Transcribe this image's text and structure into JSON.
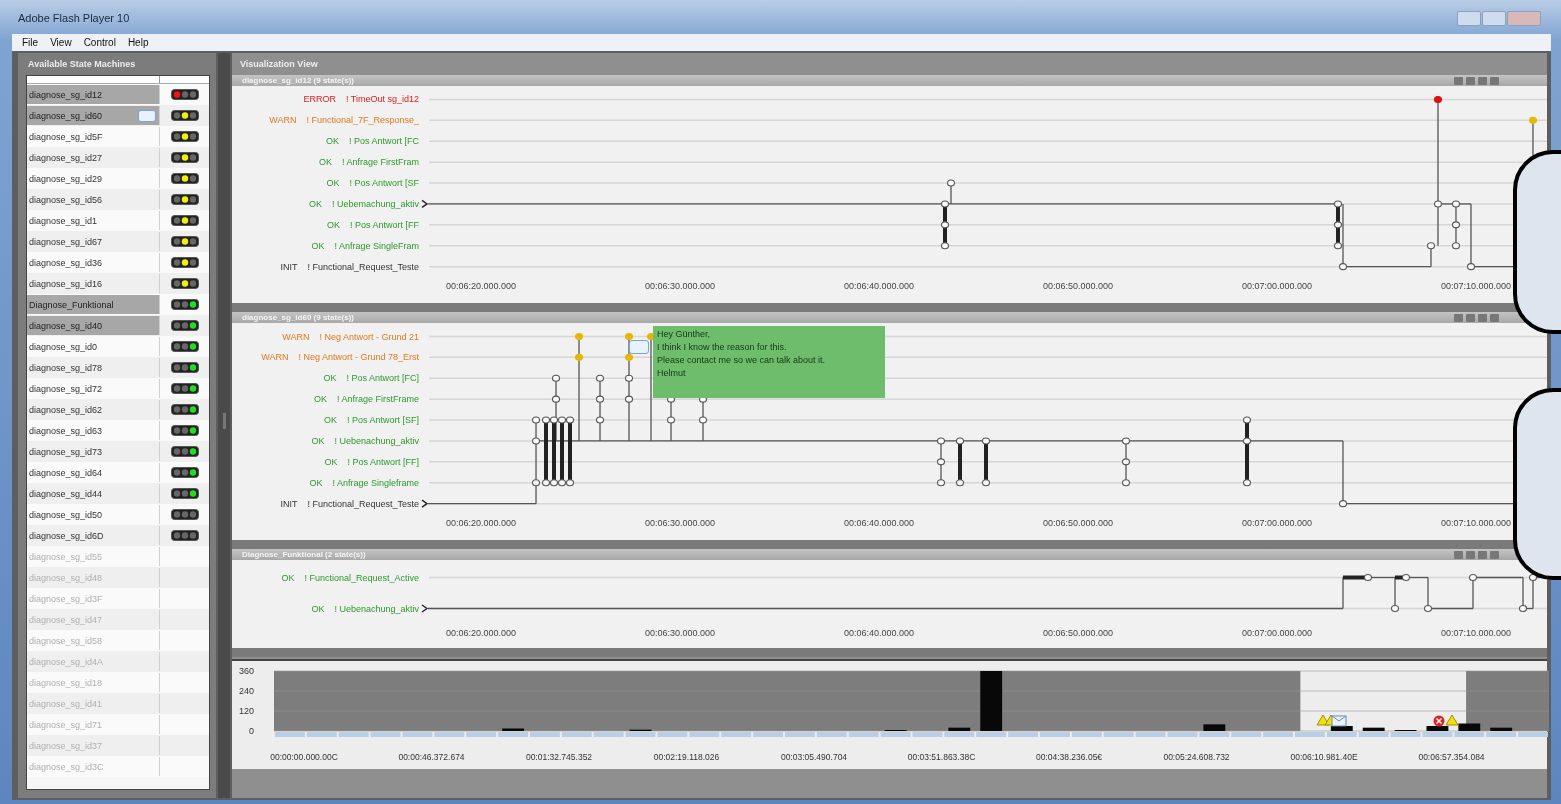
{
  "window": {
    "title": "Adobe Flash Player 10"
  },
  "menu": [
    "File",
    "View",
    "Control",
    "Help"
  ],
  "sidebar": {
    "title": "Available State Machines",
    "items": [
      {
        "name": "diagnose_sg_id12",
        "selected": true,
        "enabled": true,
        "color": "#ff1010"
      },
      {
        "name": "diagnose_sg_id60",
        "selected": true,
        "enabled": true,
        "color": "#f2f200",
        "message": true
      },
      {
        "name": "diagnose_sg_id5F",
        "selected": false,
        "enabled": true,
        "color": "#f2f200"
      },
      {
        "name": "diagnose_sg_id27",
        "selected": false,
        "enabled": true,
        "color": "#f2f200"
      },
      {
        "name": "diagnose_sg_id29",
        "selected": false,
        "enabled": true,
        "color": "#f2f200"
      },
      {
        "name": "diagnose_sg_id56",
        "selected": false,
        "enabled": true,
        "color": "#f2f200"
      },
      {
        "name": "diagnose_sg_id1",
        "selected": false,
        "enabled": true,
        "color": "#f2f200"
      },
      {
        "name": "diagnose_sg_id67",
        "selected": false,
        "enabled": true,
        "color": "#f2f200"
      },
      {
        "name": "diagnose_sg_id36",
        "selected": false,
        "enabled": true,
        "color": "#f2f200"
      },
      {
        "name": "diagnose_sg_id16",
        "selected": false,
        "enabled": true,
        "color": "#f2f200"
      },
      {
        "name": "Diagnose_Funktional",
        "selected": true,
        "enabled": true,
        "color": "#22dd22"
      },
      {
        "name": "diagnose_sg_id40",
        "selected": true,
        "enabled": true,
        "color": "#22dd22"
      },
      {
        "name": "diagnose_sg_id0",
        "selected": false,
        "enabled": true,
        "color": "#22dd22"
      },
      {
        "name": "diagnose_sg_id78",
        "selected": false,
        "enabled": true,
        "color": "#22dd22"
      },
      {
        "name": "diagnose_sg_id72",
        "selected": false,
        "enabled": true,
        "color": "#22dd22"
      },
      {
        "name": "diagnose_sg_id62",
        "selected": false,
        "enabled": true,
        "color": "#22dd22"
      },
      {
        "name": "diagnose_sg_id63",
        "selected": false,
        "enabled": true,
        "color": "#22dd22"
      },
      {
        "name": "diagnose_sg_id73",
        "selected": false,
        "enabled": true,
        "color": "#22dd22"
      },
      {
        "name": "diagnose_sg_id64",
        "selected": false,
        "enabled": true,
        "color": "#22dd22"
      },
      {
        "name": "diagnose_sg_id44",
        "selected": false,
        "enabled": true,
        "color": "#22dd22"
      },
      {
        "name": "diagnose_sg_id50",
        "selected": false,
        "enabled": true
      },
      {
        "name": "diagnose_sg_id6D",
        "selected": false,
        "enabled": true
      },
      {
        "name": "diagnose_sg_id55",
        "selected": false,
        "enabled": false
      },
      {
        "name": "diagnose_sg_id48",
        "selected": false,
        "enabled": false
      },
      {
        "name": "diagnose_sg_id3F",
        "selected": false,
        "enabled": false
      },
      {
        "name": "diagnose_sg_id47",
        "selected": false,
        "enabled": false
      },
      {
        "name": "diagnose_sg_id58",
        "selected": false,
        "enabled": false
      },
      {
        "name": "diagnose_sg_id4A",
        "selected": false,
        "enabled": false
      },
      {
        "name": "diagnose_sg_id18",
        "selected": false,
        "enabled": false
      },
      {
        "name": "diagnose_sg_id41",
        "selected": false,
        "enabled": false
      },
      {
        "name": "diagnose_sg_id71",
        "selected": false,
        "enabled": false
      },
      {
        "name": "diagnose_sg_id37",
        "selected": false,
        "enabled": false
      },
      {
        "name": "diagnose_sg_id3C",
        "selected": false,
        "enabled": false
      }
    ]
  },
  "view": {
    "title": "Visualization View",
    "panels": [
      {
        "title": "diagnose_sg_id12  (9 state(s))",
        "states": [
          {
            "kind": "error",
            "level": "ERROR",
            "name": "! TimeOut sg_id12"
          },
          {
            "kind": "warn",
            "level": "WARN",
            "name": "! Functional_7F_Response_"
          },
          {
            "kind": "ok",
            "level": "OK",
            "name": "! Pos Antwort [FC"
          },
          {
            "kind": "ok",
            "level": "OK",
            "name": "! Anfrage FirstFram"
          },
          {
            "kind": "ok",
            "level": "OK",
            "name": "! Pos Antwort [SF"
          },
          {
            "kind": "ok",
            "level": "OK",
            "name": "! Uebemachung_aktiv",
            "start": true
          },
          {
            "kind": "ok",
            "level": "OK",
            "name": "! Pos Antwort [FF"
          },
          {
            "kind": "ok",
            "level": "OK",
            "name": "! Anfrage SingleFram"
          },
          {
            "kind": "init",
            "level": "INIT",
            "name": "! Functional_Request_Teste"
          }
        ],
        "ticks": [
          "00:06:20.000.000",
          "00:06:30.000.000",
          "00:06:40.000.000",
          "00:06:50.000.000",
          "00:07:00.000.000",
          "00:07:10.000.000"
        ]
      },
      {
        "title": "diagnose_sg_id60  (9 state(s))",
        "states": [
          {
            "kind": "warn",
            "level": "WARN",
            "name": "! Neg Antwort - Grund 21"
          },
          {
            "kind": "warn",
            "level": "WARN",
            "name": "! Neg Antwort - Grund 78_Erst"
          },
          {
            "kind": "ok",
            "level": "OK",
            "name": "! Pos Antwort [FC]"
          },
          {
            "kind": "ok",
            "level": "OK",
            "name": "! Anfrage FirstFrame"
          },
          {
            "kind": "ok",
            "level": "OK",
            "name": "! Pos Antwort [SF]"
          },
          {
            "kind": "ok",
            "level": "OK",
            "name": "! Uebenachung_aktiv"
          },
          {
            "kind": "ok",
            "level": "OK",
            "name": "! Pos Antwort [FF]"
          },
          {
            "kind": "ok",
            "level": "OK",
            "name": "! Anfrage Singleframe"
          },
          {
            "kind": "init",
            "level": "INIT",
            "name": "! Functional_Request_Teste",
            "start": true
          }
        ],
        "ticks": [
          "00:06:20.000.000",
          "00:06:30.000.000",
          "00:06:40.000.000",
          "00:06:50.000.000",
          "00:07:00.000.000",
          "00:07:10.000.000"
        ],
        "note": {
          "lines": [
            "Hey Günther,",
            "I think I know the reason for this.",
            "Please contact me so we can talk about it.",
            "Helmut"
          ]
        }
      },
      {
        "title": "Diagnose_Funktional  (2 state(s))",
        "states": [
          {
            "kind": "ok",
            "level": "OK",
            "name": "! Functional_Request_Active"
          },
          {
            "kind": "ok",
            "level": "OK",
            "name": "! Uebenachung_aktiv",
            "start": true
          }
        ],
        "ticks": [
          "00:06:20.000.000",
          "00:06:30.000.000",
          "00:06:40.000.000",
          "00:06:50.000.000",
          "00:07:00.000.000",
          "00:07:10.000.000"
        ]
      }
    ]
  },
  "histogram": {
    "x_labels": [
      "00:00:00.000.00C",
      "00:00:46.372.674",
      "00:01:32.745.352",
      "00:02:19.118.026",
      "00:03:05.490.704",
      "00:03:51.863.38C",
      "00:04:38.236.05€",
      "00:05:24.608.732",
      "00:06:10.981.40E",
      "00:06:57.354.084"
    ],
    "chart_data": {
      "type": "bar",
      "ylim": [
        0,
        360
      ],
      "yticks": [
        0,
        120,
        240,
        360
      ],
      "values": [
        0,
        0,
        0,
        0,
        0,
        0,
        0,
        15,
        0,
        0,
        0,
        8,
        0,
        0,
        0,
        0,
        0,
        0,
        0,
        6,
        0,
        20,
        360,
        0,
        0,
        0,
        0,
        0,
        0,
        40,
        0,
        0,
        0,
        30,
        20,
        6,
        30,
        45,
        20,
        0
      ]
    }
  }
}
